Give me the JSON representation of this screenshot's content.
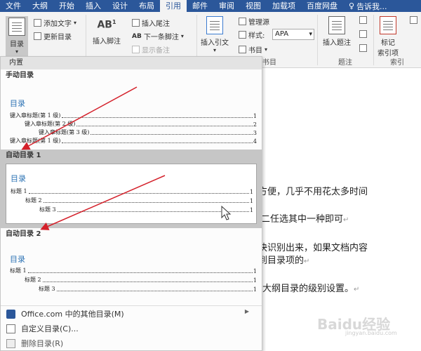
{
  "ribbon_tabs": [
    "文件",
    "大纲",
    "开始",
    "插入",
    "设计",
    "布局",
    "引用",
    "邮件",
    "审阅",
    "视图",
    "加载项",
    "百度网盘"
  ],
  "active_tab_index": 6,
  "tell_me": "告诉我...",
  "toolbar": {
    "toc_button": "目录",
    "add_text": "添加文字",
    "update_toc": "更新目录",
    "insert_footnote": "插入脚注",
    "insert_endnote": "插入尾注",
    "next_footnote": "下一条脚注",
    "show_notes": "显示备注",
    "insert_citation": "插入引文",
    "manage_sources": "管理源",
    "style_label": "样式:",
    "style_value": "APA",
    "bibliography": "书目",
    "group_citations": "书目",
    "insert_caption": "插入题注",
    "group_captions": "题注",
    "mark_entry_line1": "标记",
    "mark_entry_line2": "索引项",
    "group_index": "索引"
  },
  "dropdown": {
    "section_builtin": "内置",
    "manual_toc": {
      "title": "手动目录",
      "heading": "目录",
      "entries": [
        {
          "label": "键入章标题(第 1 级)",
          "page": "1"
        },
        {
          "label": "键入章标题(第 2 级)",
          "page": "2"
        },
        {
          "label": "键入章标题(第 3 级)",
          "page": "3"
        },
        {
          "label": "键入章标题(第 1 级)",
          "page": "4"
        }
      ]
    },
    "auto_toc_1": {
      "title": "自动目录 1",
      "heading": "目录",
      "entries": [
        {
          "label": "标题 1",
          "page": "1"
        },
        {
          "label": "标题 2",
          "page": "1"
        },
        {
          "label": "标题 3",
          "page": "1"
        }
      ]
    },
    "auto_toc_2": {
      "title": "自动目录 2",
      "heading": "目录",
      "entries": [
        {
          "label": "标题 1",
          "page": "1"
        },
        {
          "label": "标题 2",
          "page": "1"
        },
        {
          "label": "标题 3",
          "page": "1"
        }
      ]
    },
    "more_from_office": "Office.com 中的其他目录(M)",
    "custom_toc": "自定义目录(C)...",
    "remove_toc": "删除目录(R)"
  },
  "document_lines": [
    "方便，几乎不用花太多时间",
    "二任选其中一种即可",
    "快识别出来，如果文档内容",
    "到目录项的",
    "大纲目录的级别设置。"
  ],
  "watermark": {
    "text": "Baidu经验",
    "sub": "jingyan.baidu.com"
  },
  "colors": {
    "ribbon_blue": "#2b579a",
    "toc_heading_blue": "#2e74b5",
    "arrow_red": "#d4202a"
  }
}
